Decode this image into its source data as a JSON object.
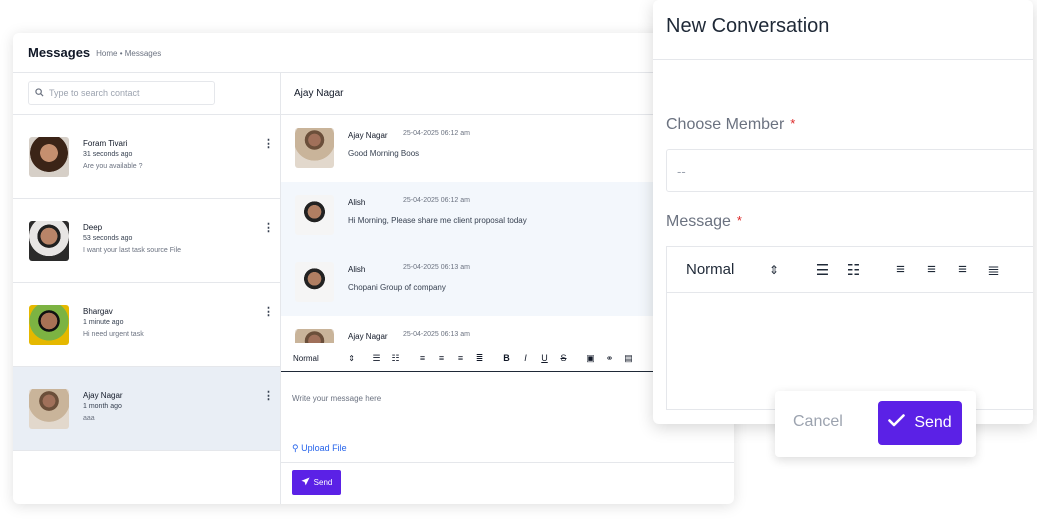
{
  "messages": {
    "title": "Messages",
    "breadcrumb": "Home • Messages",
    "search_placeholder": "Type to search contact",
    "contacts": [
      {
        "name": "Foram Tivari",
        "time": "31 seconds ago",
        "preview": "Are you available ?",
        "avatar_color": "#6b4a3a"
      },
      {
        "name": "Deep",
        "time": "53 seconds ago",
        "preview": "I want your last task source File",
        "avatar_color": "#3f3f46"
      },
      {
        "name": "Bhargav",
        "time": "1 minute ago",
        "preview": "Hi need urgent task",
        "avatar_color": "#4d7c0f"
      },
      {
        "name": "Ajay Nagar",
        "time": "1 month ago",
        "preview": "aaa",
        "avatar_color": "#a16207"
      }
    ],
    "chat": {
      "header": "Ajay Nagar",
      "items": [
        {
          "name": "Ajay Nagar",
          "time": "25-04-2025 06:12 am",
          "text": "Good Morning Boos"
        },
        {
          "name": "Alish",
          "time": "25-04-2025 06:12 am",
          "text": "Hi Morning, Please share me client proposal today"
        },
        {
          "name": "Alish",
          "time": "25-04-2025 06:13 am",
          "text": "Chopani Group of company"
        },
        {
          "name": "Ajay Nagar",
          "time": "25-04-2025 06:13 am",
          "text": ""
        }
      ],
      "toolbar_format": "Normal",
      "editor_placeholder": "Write your message here",
      "upload_label": "Upload File",
      "send_label": "Send"
    }
  },
  "new_conversation": {
    "title": "New Conversation",
    "member_label": "Choose Member",
    "member_value": "--",
    "message_label": "Message",
    "required_mark": "*",
    "toolbar_format": "Normal",
    "cancel_label": "Cancel",
    "send_label": "Send"
  },
  "colors": {
    "accent": "#5b21e6",
    "link": "#2563eb",
    "required": "#dc2626",
    "active_row": "#e9eef5"
  }
}
